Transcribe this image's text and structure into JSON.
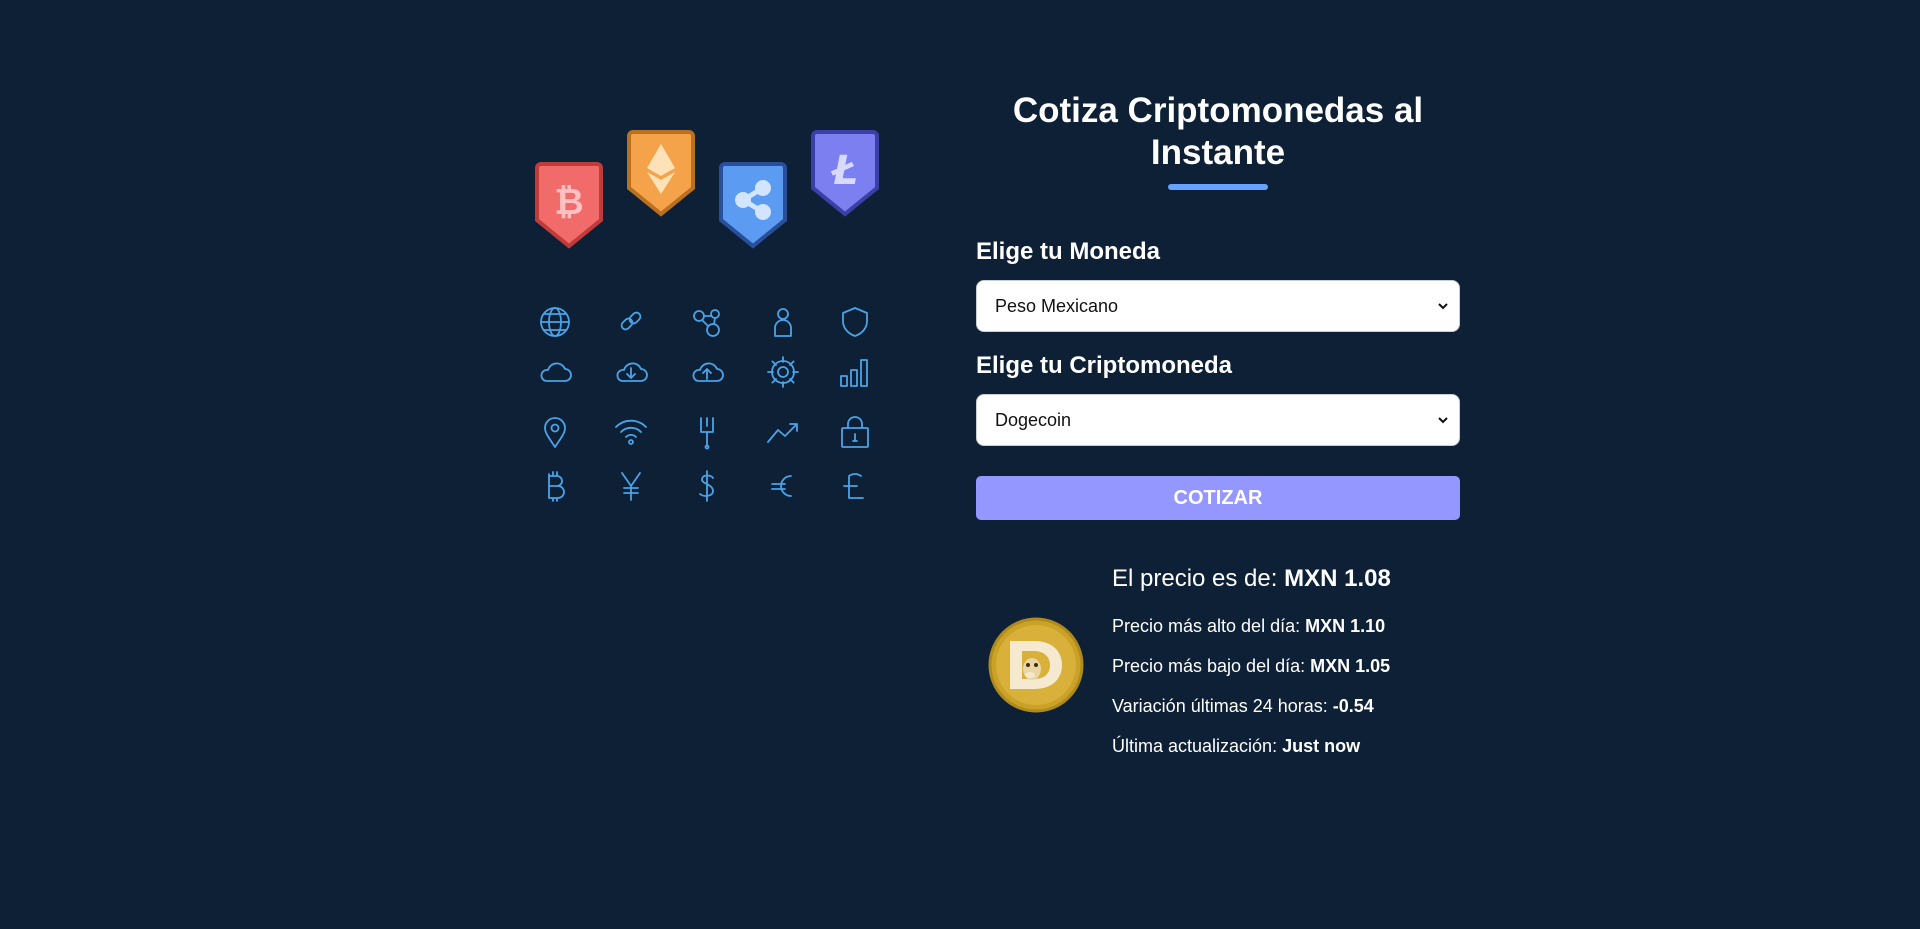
{
  "page": {
    "title_line1": "Cotiza Criptomonedas al",
    "title_line2": "Instante"
  },
  "colors": {
    "background": "#0d2035",
    "accent_underline": "#66a2fe",
    "button": "#9497ff",
    "icon_stroke": "#4aa3e8",
    "badge_bitcoin": "#f26b6b",
    "badge_ethereum": "#f5a34a",
    "badge_ripple": "#5b9cf2",
    "badge_litecoin": "#7b7ff0"
  },
  "illustration": {
    "badges": [
      "bitcoin-badge",
      "ethereum-badge",
      "ripple-badge",
      "litecoin-badge"
    ],
    "icons": [
      "globe-icon",
      "link-icon",
      "network-icon",
      "user-icon",
      "shield-icon",
      "cloud-icon",
      "cloud-download-icon",
      "cloud-upload-icon",
      "gear-icon",
      "bar-chart-icon",
      "location-pin-icon",
      "wifi-icon",
      "circuit-icon",
      "trend-up-icon",
      "lock-icon",
      "bitcoin-symbol-icon",
      "yen-symbol-icon",
      "dollar-symbol-icon",
      "euro-symbol-icon",
      "litecoin-symbol-icon"
    ]
  },
  "form": {
    "currency_label": "Elige tu Moneda",
    "currency_value": "Peso Mexicano",
    "crypto_label": "Elige tu Criptomoneda",
    "crypto_value": "Dogecoin",
    "submit_label": "Cotizar"
  },
  "result": {
    "coin_icon": "dogecoin-logo",
    "price_label": "El precio es de: ",
    "price_value": "MXN 1.08",
    "high_label": "Precio más alto del día: ",
    "high_value": "MXN 1.10",
    "low_label": "Precio más bajo del día: ",
    "low_value": "MXN 1.05",
    "change_label": "Variación últimas 24 horas: ",
    "change_value": "-0.54",
    "updated_label": "Última actualización: ",
    "updated_value": "Just now"
  }
}
